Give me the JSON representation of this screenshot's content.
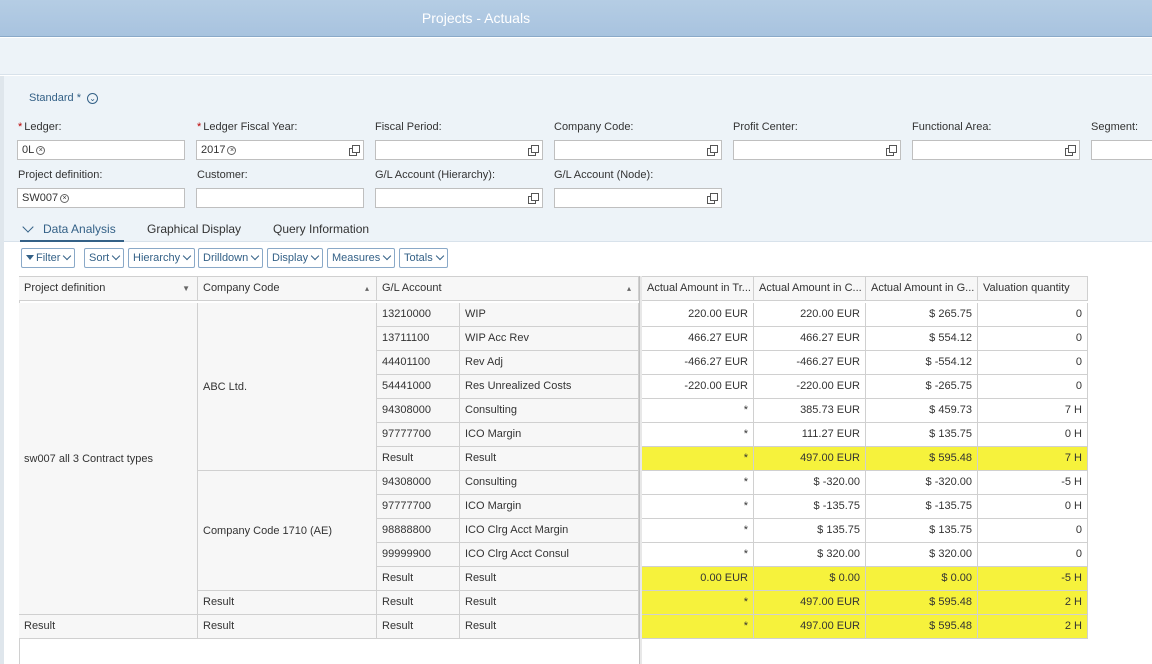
{
  "app": {
    "title": "Projects - Actuals"
  },
  "variant": {
    "label": "Standard *",
    "chevron_icon": "chevron-down-icon"
  },
  "filters": {
    "ledger": {
      "label": "Ledger:",
      "required": true,
      "token": "0L"
    },
    "ledger_fiscal_year": {
      "label": "Ledger Fiscal Year:",
      "required": true,
      "token": "2017"
    },
    "fiscal_period": {
      "label": "Fiscal Period:"
    },
    "company_code": {
      "label": "Company Code:"
    },
    "profit_center": {
      "label": "Profit Center:"
    },
    "functional_area": {
      "label": "Functional Area:"
    },
    "segment": {
      "label": "Segment:"
    },
    "project_definition": {
      "label": "Project definition:",
      "token": "SW007"
    },
    "customer": {
      "label": "Customer:"
    },
    "gl_account_hierarchy": {
      "label": "G/L Account (Hierarchy):"
    },
    "gl_account_node": {
      "label": "G/L Account (Node):"
    }
  },
  "tabs": [
    {
      "label": "Data Analysis",
      "selected": true
    },
    {
      "label": "Graphical Display",
      "selected": false
    },
    {
      "label": "Query Information",
      "selected": false
    }
  ],
  "toolbar": {
    "filter": "Filter",
    "sort": "Sort",
    "hierarchy": "Hierarchy",
    "drilldown": "Drilldown",
    "display": "Display",
    "measures": "Measures",
    "totals": "Totals"
  },
  "grid": {
    "headers": {
      "project_definition": "Project definition",
      "company_code": "Company Code",
      "gl_account": "G/L Account",
      "amt_tr": "Actual Amount in Tr...",
      "amt_c": "Actual Amount in C...",
      "amt_g": "Actual Amount in G...",
      "valuation_qty": "Valuation quantity"
    },
    "project_label": "sw007 all 3 Contract types",
    "company_1": "ABC Ltd.",
    "company_2": "Company Code 1710 (AE)",
    "result_label": "Result",
    "rows": [
      {
        "acct": "13210000",
        "desc": "WIP",
        "tr": "220.00 EUR",
        "c": "220.00 EUR",
        "g": "$ 265.75",
        "q": "0"
      },
      {
        "acct": "13711100",
        "desc": "WIP Acc Rev",
        "tr": "466.27 EUR",
        "c": "466.27 EUR",
        "g": "$ 554.12",
        "q": "0"
      },
      {
        "acct": "44401100",
        "desc": "Rev Adj",
        "tr": "-466.27 EUR",
        "c": "-466.27 EUR",
        "g": "$ -554.12",
        "q": "0"
      },
      {
        "acct": "54441000",
        "desc": "Res Unrealized Costs",
        "tr": "-220.00 EUR",
        "c": "-220.00 EUR",
        "g": "$ -265.75",
        "q": "0"
      },
      {
        "acct": "94308000",
        "desc": "Consulting",
        "tr": "*",
        "c": "385.73 EUR",
        "g": "$ 459.73",
        "q": "7 H"
      },
      {
        "acct": "97777700",
        "desc": "ICO Margin",
        "tr": "*",
        "c": "111.27 EUR",
        "g": "$ 135.75",
        "q": "0 H"
      },
      {
        "acct": "Result",
        "desc": "Result",
        "tr": "*",
        "c": "497.00 EUR",
        "g": "$ 595.48",
        "q": "7 H"
      },
      {
        "acct": "94308000",
        "desc": "Consulting",
        "tr": "*",
        "c": "$ -320.00",
        "g": "$ -320.00",
        "q": "-5 H"
      },
      {
        "acct": "97777700",
        "desc": "ICO Margin",
        "tr": "*",
        "c": "$ -135.75",
        "g": "$ -135.75",
        "q": "0 H"
      },
      {
        "acct": "98888800",
        "desc": "ICO Clrg Acct Margin",
        "tr": "*",
        "c": "$ 135.75",
        "g": "$ 135.75",
        "q": "0"
      },
      {
        "acct": "99999900",
        "desc": "ICO Clrg Acct Consul",
        "tr": "*",
        "c": "$ 320.00",
        "g": "$ 320.00",
        "q": "0"
      },
      {
        "acct": "Result",
        "desc": "Result",
        "tr": "0.00 EUR",
        "c": "$ 0.00",
        "g": "$ 0.00",
        "q": "-5 H"
      },
      {
        "acct": "Result",
        "desc": "Result",
        "tr": "*",
        "c": "497.00 EUR",
        "g": "$ 595.48",
        "q": "2 H"
      },
      {
        "acct": "Result",
        "desc": "Result",
        "tr": "*",
        "c": "497.00 EUR",
        "g": "$ 595.48",
        "q": "2 H"
      }
    ]
  },
  "colors": {
    "highlight": "#f6f23c",
    "brand": "#346187",
    "shell": "#a8c3df"
  }
}
